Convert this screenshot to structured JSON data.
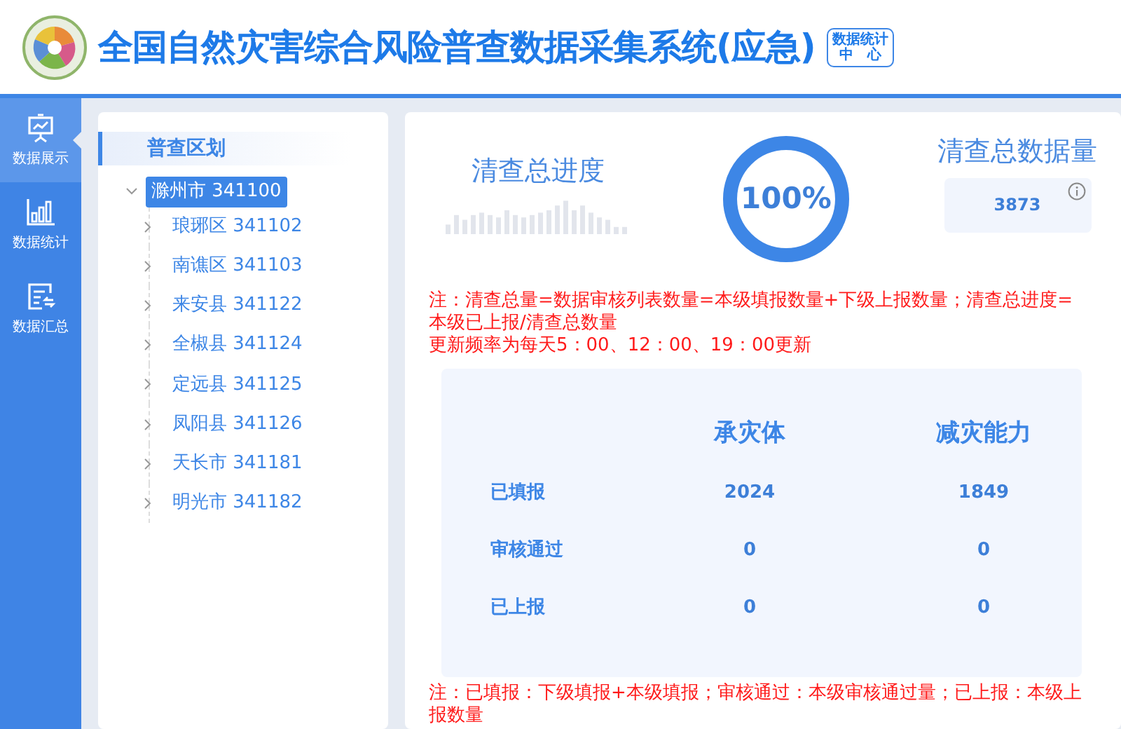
{
  "header": {
    "title": "全国自然灾害综合风险普查数据采集系统(应急)",
    "badge_lines": [
      "数据统计",
      "中　心"
    ]
  },
  "sidebar": {
    "items": [
      {
        "label": "数据展示",
        "selected": true
      },
      {
        "label": "数据统计",
        "selected": false
      },
      {
        "label": "数据汇总",
        "selected": false
      }
    ]
  },
  "tree": {
    "title": "普查区划",
    "root": {
      "label": "滁州市 341100",
      "selected": true,
      "expanded": true,
      "children": [
        {
          "label": "琅琊区 341102",
          "selected": false,
          "expanded": false
        },
        {
          "label": "南谯区 341103",
          "selected": false,
          "expanded": false
        },
        {
          "label": "来安县 341122",
          "selected": false,
          "expanded": false
        },
        {
          "label": "全椒县 341124",
          "selected": false,
          "expanded": false
        },
        {
          "label": "定远县 341125",
          "selected": false,
          "expanded": false
        },
        {
          "label": "凤阳县 341126",
          "selected": false,
          "expanded": false
        },
        {
          "label": "天长市 341181",
          "selected": false,
          "expanded": false
        },
        {
          "label": "明光市 341182",
          "selected": false,
          "expanded": false
        }
      ]
    }
  },
  "progress": {
    "title": "清查总进度",
    "percent": "100%",
    "level": 1
  },
  "total": {
    "title": "清查总数据量",
    "value": "3873"
  },
  "notes": [
    "注：清查总量=数据审核列表数量=本级填报数量+下级上报数量；清查总进度=本级已上报/清查总数量",
    "更新频率为每天5：00、12：00、19：00更新"
  ],
  "stats": {
    "columns": [
      "承灾体",
      "减灾能力"
    ],
    "rows": [
      {
        "label": "已填报",
        "values": [
          "2024",
          "1849"
        ]
      },
      {
        "label": "审核通过",
        "values": [
          "0",
          "0"
        ]
      },
      {
        "label": "已上报",
        "values": [
          "0",
          "0"
        ]
      }
    ]
  },
  "footnote": "注：已填报：下级填报+本级填报；审核通过：本级审核通过量；已上报：本级上报数量"
}
